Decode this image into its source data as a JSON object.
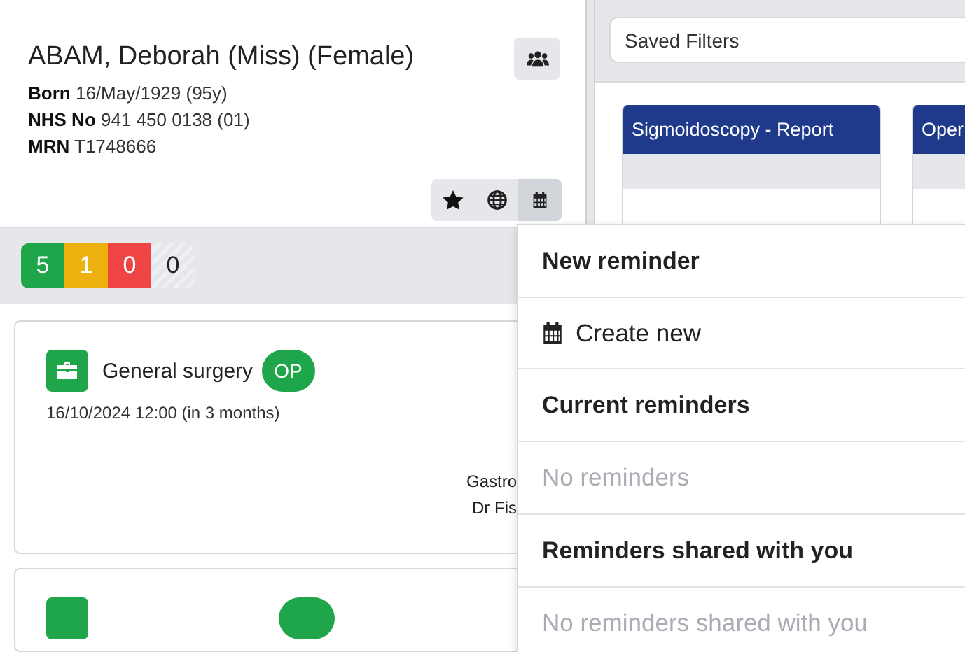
{
  "patient": {
    "name": "ABAM, Deborah (Miss) (Female)",
    "details": [
      {
        "label": "Born",
        "value": "16/May/1929 (95y)"
      },
      {
        "label": "NHS No",
        "value": "941 450 0138 (01)"
      },
      {
        "label": "MRN",
        "value": "T1748666"
      }
    ]
  },
  "toolbar": [
    {
      "kind": "star",
      "selected": false
    },
    {
      "kind": "globe",
      "selected": false
    },
    {
      "kind": "calendar",
      "selected": true
    }
  ],
  "counts": [
    {
      "kind": "solid",
      "value": "5",
      "color": "#1fa54a"
    },
    {
      "kind": "solid",
      "value": "1",
      "color": "#ecb10f"
    },
    {
      "kind": "solid",
      "value": "0",
      "color": "#ee4444"
    },
    {
      "kind": "striped",
      "value": "0"
    }
  ],
  "events": [
    {
      "kind": "full",
      "title": "General surgery",
      "badge": "OP",
      "datetime": "16/10/2024 12:00 (in 3 months)",
      "details": [
        "Gastro",
        "Dr Fis"
      ]
    },
    {
      "kind": "clipped"
    }
  ],
  "saved_filters": {
    "placeholder": "Saved Filters"
  },
  "columns": [
    {
      "title": "Sigmoidoscopy - Report"
    },
    {
      "title": "Oper"
    }
  ],
  "reminder_menu": [
    {
      "kind": "heading",
      "label": "New reminder"
    },
    {
      "kind": "action",
      "label": "Create new"
    },
    {
      "kind": "heading",
      "label": "Current reminders"
    },
    {
      "kind": "empty",
      "label": "No reminders"
    },
    {
      "kind": "heading",
      "label": "Reminders shared with you"
    },
    {
      "kind": "empty",
      "label": "No reminders shared with you"
    }
  ]
}
